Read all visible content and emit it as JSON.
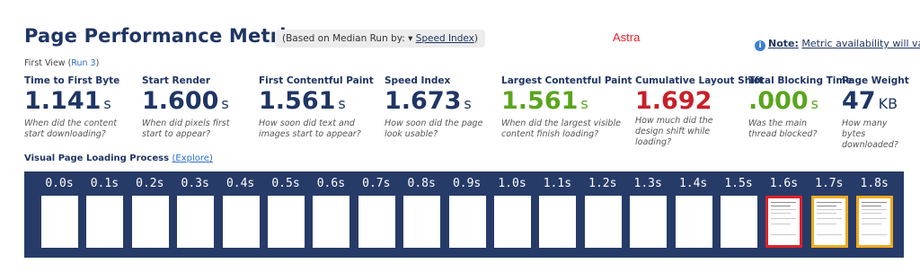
{
  "header": {
    "title": "Page Performance Metrics",
    "median_prefix": "(Based on Median Run by: ▾",
    "median_link": "Speed Index",
    "median_suffix": ")",
    "site_label": "Astra",
    "note_label": "Note:",
    "note_text": "Metric availability will vary"
  },
  "first_view": {
    "label": "First View (",
    "run_link": "Run 3",
    "suffix": ")"
  },
  "metrics": [
    {
      "label": "Time to First Byte",
      "value": "1.141",
      "unit": "s",
      "desc": "When did the content start downloading?",
      "color": "#1f3564"
    },
    {
      "label": "Start Render",
      "value": "1.600",
      "unit": "s",
      "desc": "When did pixels first start to appear?",
      "color": "#1f3564"
    },
    {
      "label": "First Contentful Paint",
      "value": "1.561",
      "unit": "s",
      "desc": "How soon did text and images start to appear?",
      "color": "#1f3564"
    },
    {
      "label": "Speed Index",
      "value": "1.673",
      "unit": "s",
      "desc": "How soon did the page look usable?",
      "color": "#1f3564"
    },
    {
      "label": "Largest Contentful Paint",
      "value": "1.561",
      "unit": "s",
      "desc": "When did the largest visible content finish loading?",
      "color": "#5aa51e"
    },
    {
      "label": "Cumulative Layout Shift",
      "value": "1.692",
      "unit": "",
      "desc": "How much did the design shift while loading?",
      "color": "#c8202a"
    },
    {
      "label": "Total Blocking Time",
      "value": ".000",
      "unit": "s",
      "desc": "Was the main thread blocked?",
      "color": "#5aa51e"
    },
    {
      "label": "Page Weight",
      "value": "47",
      "unit": "KB",
      "desc": "How many bytes downloaded?",
      "color": "#1f3564"
    }
  ],
  "visual_progress": {
    "title": "Visual Page Loading Process",
    "explore_prefix": "(",
    "explore_link": "Explore",
    "explore_suffix": ")",
    "frames": [
      "0.0s",
      "0.1s",
      "0.2s",
      "0.3s",
      "0.4s",
      "0.5s",
      "0.6s",
      "0.7s",
      "0.8s",
      "0.9s",
      "1.0s",
      "1.1s",
      "1.2s",
      "1.3s",
      "1.4s",
      "1.5s",
      "1.6s",
      "1.7s",
      "1.8s"
    ],
    "highlighted_frames": {
      "1.6s": "red",
      "1.7s": "orange",
      "1.8s": "orange"
    }
  }
}
